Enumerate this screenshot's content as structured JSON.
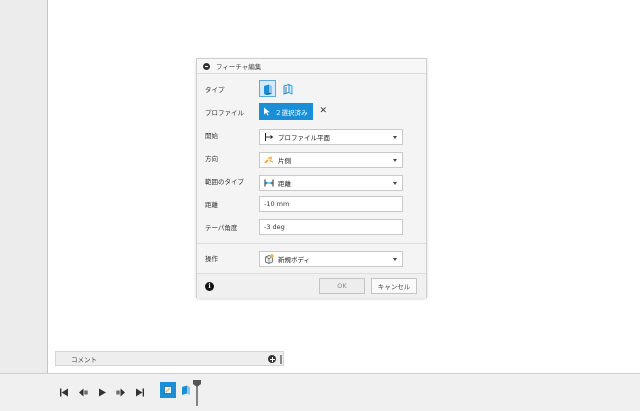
{
  "dialog": {
    "title": "フィーチャ編集",
    "rows": {
      "type": {
        "label": "タイプ",
        "options": [
          "solid-extrude-icon",
          "surface-extrude-icon"
        ],
        "selected": "solid-extrude-icon"
      },
      "profile": {
        "label": "プロファイル",
        "selection_text": "２選択済み"
      },
      "start": {
        "label": "開始",
        "value": "プロファイル平面"
      },
      "direction": {
        "label": "方向",
        "value": "片側"
      },
      "extent_type": {
        "label": "範囲のタイプ",
        "value": "距離"
      },
      "distance": {
        "label": "距離",
        "value": "-10 mm"
      },
      "taper_angle": {
        "label": "テーパ角度",
        "value": "-3 deg"
      },
      "operation": {
        "label": "操作",
        "value": "新規ボディ"
      }
    },
    "ok_label": "OK",
    "cancel_label": "キャンセル"
  },
  "comment_bar": {
    "label": "コメント"
  },
  "timeline": {
    "controls": [
      "skip-to-start-icon",
      "step-back-icon",
      "play-icon",
      "step-forward-icon",
      "skip-to-end-icon"
    ],
    "items": [
      "sketch-feature-icon",
      "extrude-feature-icon"
    ]
  },
  "colors": {
    "accent": "#1a8fd6",
    "panel": "#f4f4f4",
    "rail": "#ececec"
  }
}
